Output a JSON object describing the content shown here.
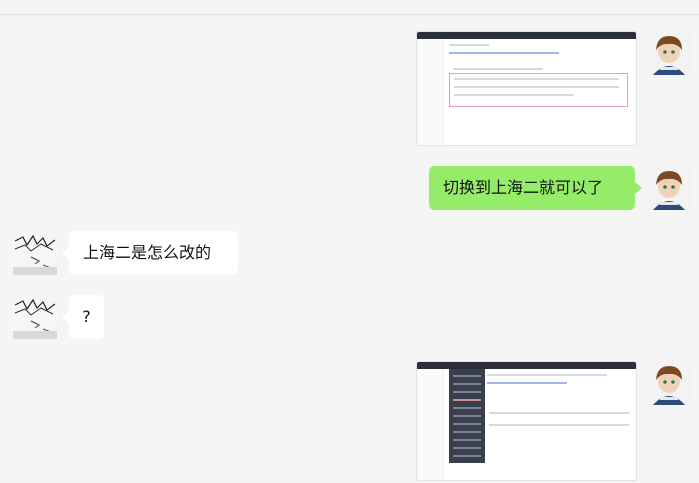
{
  "messages": [
    {
      "id": "m1",
      "side": "right",
      "type": "image",
      "alt": "screenshot-table-red-box"
    },
    {
      "id": "m2",
      "side": "right",
      "type": "text",
      "text": "切换到上海二就可以了"
    },
    {
      "id": "m3",
      "side": "left",
      "type": "text",
      "text": "上海二是怎么改的"
    },
    {
      "id": "m4",
      "side": "left",
      "type": "text",
      "text": "?"
    },
    {
      "id": "m5",
      "side": "right",
      "type": "image",
      "alt": "screenshot-region-dropdown"
    }
  ],
  "colors": {
    "background": "#f5f5f5",
    "bubble_self": "#95ec69",
    "bubble_other": "#ffffff"
  },
  "icons": {
    "self_avatar": "boy-avatar-icon",
    "other_avatar": "scribble-avatar-icon"
  }
}
